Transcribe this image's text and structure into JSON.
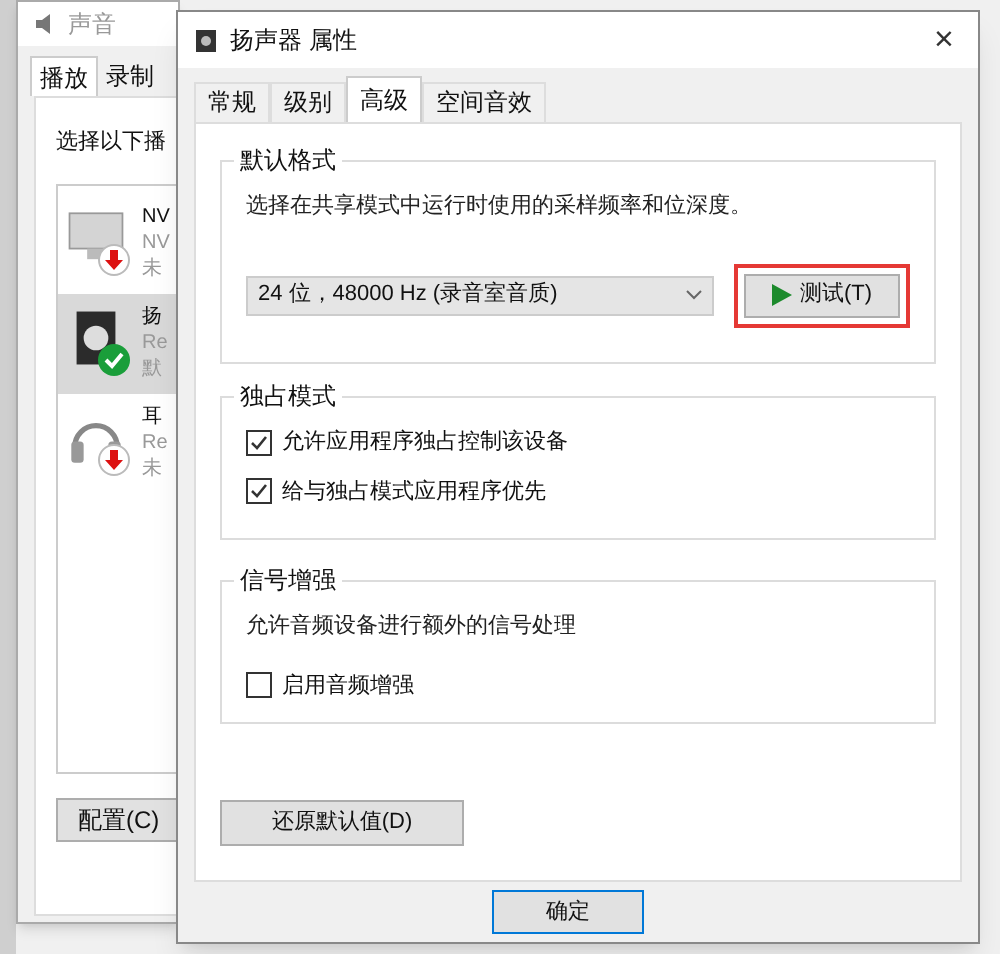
{
  "back_window": {
    "title": "声音",
    "tabs": [
      {
        "label": "播放",
        "selected": true
      },
      {
        "label": "录制",
        "selected": false
      }
    ],
    "instruction": "选择以下播",
    "devices": [
      {
        "kind": "monitor",
        "lines": [
          "NV",
          "NV",
          "未"
        ],
        "selected": false,
        "default": false
      },
      {
        "kind": "speaker",
        "lines": [
          "扬",
          "Re",
          "默"
        ],
        "selected": true,
        "default": true
      },
      {
        "kind": "headphones",
        "lines": [
          "耳",
          "Re",
          "未"
        ],
        "selected": false,
        "default": false
      }
    ],
    "configure_button": "配置(C)"
  },
  "dialog": {
    "title": "扬声器 属性",
    "close": "×",
    "tabs": [
      {
        "label": "常规",
        "selected": false
      },
      {
        "label": "级别",
        "selected": false
      },
      {
        "label": "高级",
        "selected": true
      },
      {
        "label": "空间音效",
        "selected": false
      }
    ],
    "default_format": {
      "heading": "默认格式",
      "description": "选择在共享模式中运行时使用的采样频率和位深度。",
      "format_value": "24 位，48000 Hz (录音室音质)",
      "test_button": "测试(T)",
      "highlighted": true
    },
    "exclusive_mode": {
      "heading": "独占模式",
      "options": [
        {
          "label": "允许应用程序独占控制该设备",
          "checked": true
        },
        {
          "label": "给与独占模式应用程序优先",
          "checked": true
        }
      ]
    },
    "signal_enhancement": {
      "heading": "信号增强",
      "description": "允许音频设备进行额外的信号处理",
      "options": [
        {
          "label": "启用音频增强",
          "checked": false
        }
      ]
    },
    "restore_button": "还原默认值(D)",
    "ok_button": "确定"
  }
}
